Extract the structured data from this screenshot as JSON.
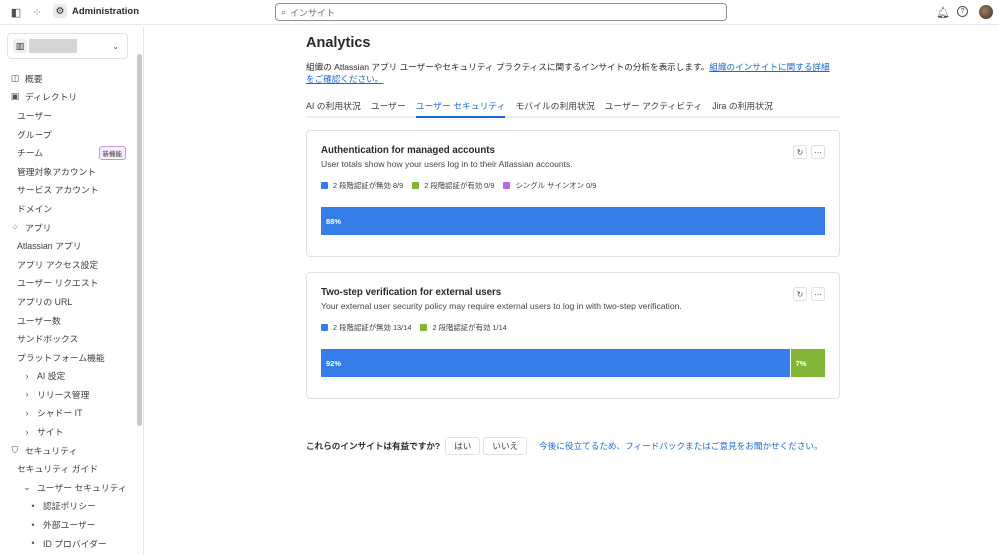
{
  "topbar": {
    "app_title": "Administration",
    "search_placeholder": "インサイト"
  },
  "sidebar": {
    "items": [
      {
        "label": "概要",
        "icon": "overview-icon",
        "level": 0
      },
      {
        "label": "ディレクトリ",
        "icon": "directory-icon",
        "level": 0
      },
      {
        "label": "ユーザー",
        "level": 1
      },
      {
        "label": "グループ",
        "level": 1
      },
      {
        "label": "チーム",
        "level": 1,
        "badge": "新機能"
      },
      {
        "label": "管理対象アカウント",
        "level": 1
      },
      {
        "label": "サービス アカウント",
        "level": 1
      },
      {
        "label": "ドメイン",
        "level": 1
      },
      {
        "label": "アプリ",
        "icon": "apps-icon",
        "level": 0
      },
      {
        "label": "Atlassian アプリ",
        "level": 1
      },
      {
        "label": "アプリ アクセス設定",
        "level": 1
      },
      {
        "label": "ユーザー リクエスト",
        "level": 1
      },
      {
        "label": "アプリの URL",
        "level": 1
      },
      {
        "label": "ユーザー数",
        "level": 1
      },
      {
        "label": "サンドボックス",
        "level": 1
      },
      {
        "label": "プラットフォーム機能",
        "level": 1
      },
      {
        "label": "AI 設定",
        "level": 2,
        "chevron": "›"
      },
      {
        "label": "リリース管理",
        "level": 2,
        "chevron": "›"
      },
      {
        "label": "シャドー IT",
        "level": 2,
        "chevron": "›"
      },
      {
        "label": "サイト",
        "level": 2,
        "chevron": "›"
      },
      {
        "label": "セキュリティ",
        "icon": "shield-icon",
        "level": 0
      },
      {
        "label": "セキュリティ ガイド",
        "level": 1
      },
      {
        "label": "ユーザー セキュリティ",
        "level": 2,
        "chevron": "⌄"
      },
      {
        "label": "認証ポリシー",
        "level": 3,
        "bullet": "•"
      },
      {
        "label": "外部ユーザー",
        "level": 3,
        "bullet": "•"
      },
      {
        "label": "ID プロバイダー",
        "level": 3,
        "bullet": "•"
      }
    ]
  },
  "main": {
    "title": "Analytics",
    "description": "組織の Atlassian アプリ ユーザーやセキュリティ プラクティスに関するインサイトの分析を表示します。",
    "description_link": "組織のインサイトに関する詳細をご確認ください。",
    "tabs": [
      "AI の利用状況",
      "ユーザー",
      "ユーザー セキュリティ",
      "モバイルの利用状況",
      "ユーザー アクティビティ",
      "Jira の利用状況"
    ],
    "active_tab": 2,
    "cards": [
      {
        "title": "Authentication for managed accounts",
        "subtitle": "User totals show how your users log in to their Atlassian accounts.",
        "legend": [
          {
            "label": "2 段階認証が無効 8/9",
            "color": "#357de8"
          },
          {
            "label": "2 段階認証が有効 0/9",
            "color": "#82b536"
          },
          {
            "label": "シングル サインオン 0/9",
            "color": "#bf63f3"
          }
        ],
        "segments": [
          {
            "label": "88%",
            "value": 100,
            "color": "#357de8"
          }
        ]
      },
      {
        "title": "Two-step verification for external users",
        "subtitle": "Your external user security policy may require external users to log in with two-step verification.",
        "legend": [
          {
            "label": "2 段階認証が無効 13/14",
            "color": "#357de8"
          },
          {
            "label": "2 段階認証が有効 1/14",
            "color": "#82b536"
          }
        ],
        "segments": [
          {
            "label": "92%",
            "value": 93,
            "color": "#357de8"
          },
          {
            "label": "7%",
            "value": 7,
            "color": "#82b536"
          }
        ]
      }
    ],
    "feedback": {
      "question": "これらのインサイトは有益ですか?",
      "yes": "はい",
      "no": "いいえ",
      "link": "今後に役立てるため、フィードバックまたはご意見をお聞かせください。"
    }
  }
}
